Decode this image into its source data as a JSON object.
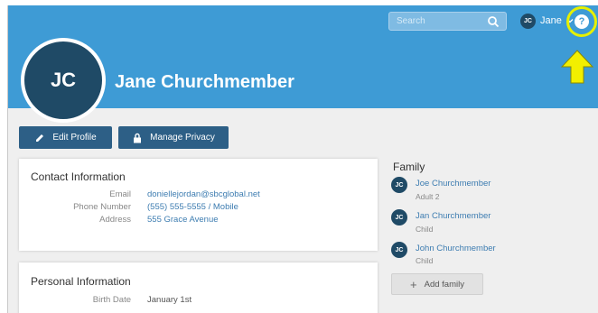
{
  "header": {
    "search_placeholder": "Search",
    "user_initials": "JC",
    "user_name": "Jane",
    "help_symbol": "?",
    "highlight_color": "#e6f000"
  },
  "profile": {
    "initials": "JC",
    "name": "Jane Churchmember"
  },
  "actions": {
    "edit_label": "Edit Profile",
    "privacy_label": "Manage Privacy"
  },
  "contact": {
    "title": "Contact Information",
    "rows": [
      {
        "label": "Email",
        "value": "doniellejordan@sbcglobal.net"
      },
      {
        "label": "Phone Number",
        "value": "(555) 555-5555 / Mobile"
      },
      {
        "label": "Address",
        "value": "555 Grace Avenue"
      }
    ]
  },
  "personal": {
    "title": "Personal Information",
    "rows": [
      {
        "label": "Birth Date",
        "value": "January 1st"
      }
    ]
  },
  "family": {
    "title": "Family",
    "members": [
      {
        "initials": "JC",
        "name": "Joe Churchmember",
        "relation": "Adult 2"
      },
      {
        "initials": "JC",
        "name": "Jan Churchmember",
        "relation": "Child"
      },
      {
        "initials": "JC",
        "name": "John Churchmember",
        "relation": "Child"
      }
    ],
    "add_label": "Add family"
  },
  "colors": {
    "hero": "#3e9bd5",
    "avatar": "#1f4a66",
    "button": "#2d5f86",
    "link": "#3e7db1"
  }
}
